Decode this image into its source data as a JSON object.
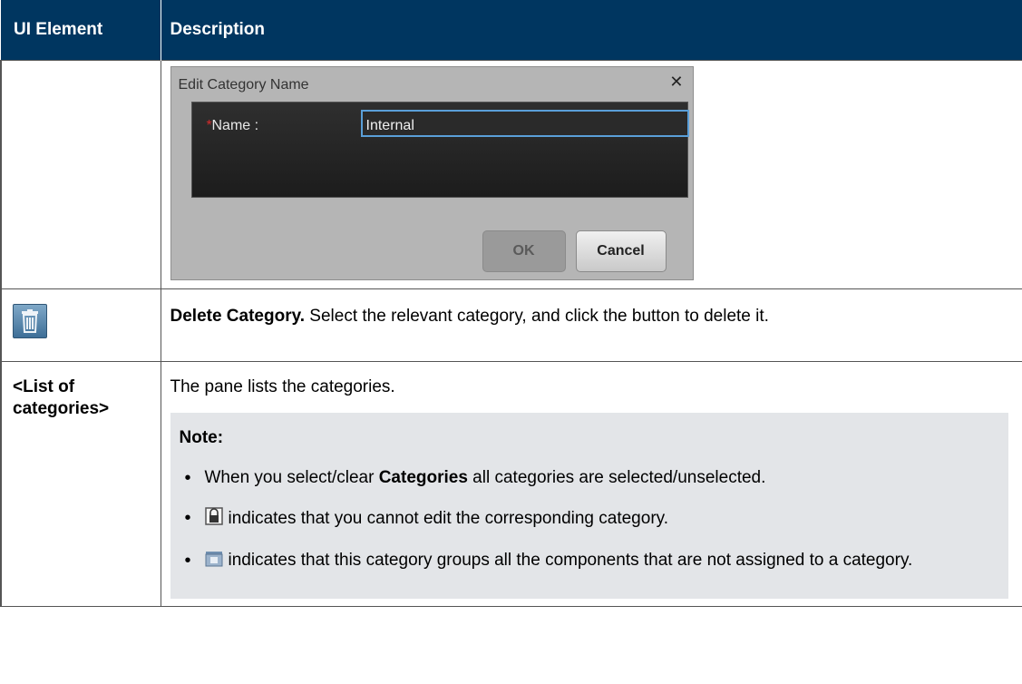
{
  "header": {
    "col1": "UI Element",
    "col2": "Description"
  },
  "edit_dialog": {
    "title": "Edit Category Name",
    "close_glyph": "✕",
    "required_mark": "*",
    "name_label": "Name :",
    "name_value": "Internal",
    "ok_label": "OK",
    "cancel_label": "Cancel"
  },
  "delete_row": {
    "icon": "trash-icon",
    "title": "Delete Category.",
    "text": " Select the relevant category, and click the button to delete it."
  },
  "list_row": {
    "element": "<List of categories>",
    "text": "The pane lists the categories.",
    "note_heading": "Note:",
    "note1_before": "When you select/clear ",
    "note1_bold": "Categories",
    "note1_after": " all categories are selected/unselected.",
    "note2_icon": "lock-icon",
    "note2_text": "indicates that you cannot edit the corresponding category.",
    "note3_icon": "uncategorized-icon",
    "note3_text": "indicates that this category groups all the components that are not assigned to a category."
  },
  "colors": {
    "header_bg": "#003660",
    "note_bg": "#e3e5e8",
    "input_border": "#5a9fd8"
  }
}
